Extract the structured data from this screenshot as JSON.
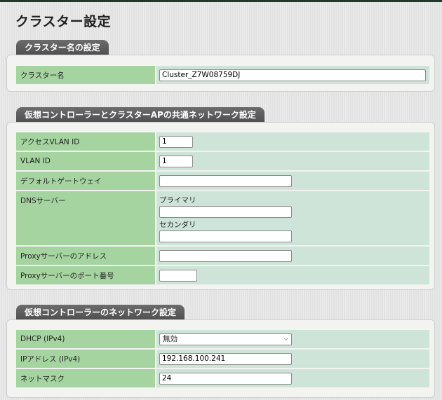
{
  "page_title": "クラスター設定",
  "cluster_name_section": {
    "title": "クラスター名の設定",
    "label": "クラスター名",
    "value": "Cluster_Z7W08759DJ"
  },
  "common_network_section": {
    "title": "仮想コントローラーとクラスターAPの共通ネットワーク設定",
    "access_vlan": {
      "label": "アクセスVLAN ID",
      "value": "1"
    },
    "vlan_id": {
      "label": "VLAN ID",
      "value": "1"
    },
    "gateway": {
      "label": "デフォルトゲートウェイ",
      "value": ""
    },
    "dns": {
      "label": "DNSサーバー",
      "primary_label": "プライマリ",
      "primary_value": "",
      "secondary_label": "セカンダリ",
      "secondary_value": ""
    },
    "proxy_address": {
      "label": "Proxyサーバーのアドレス",
      "value": ""
    },
    "proxy_port": {
      "label": "Proxyサーバーのポート番号",
      "value": ""
    }
  },
  "vc_network_section": {
    "title": "仮想コントローラーのネットワーク設定",
    "dhcp": {
      "label": "DHCP (IPv4)",
      "selected": "無効"
    },
    "ip": {
      "label": "IPアドレス (IPv4)",
      "value": "192.168.100.241"
    },
    "netmask": {
      "label": "ネットマスク",
      "value": "24"
    }
  }
}
